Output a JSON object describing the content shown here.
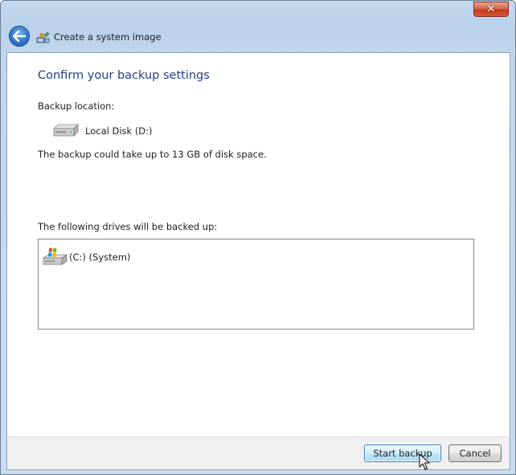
{
  "window": {
    "title": "Create a system image",
    "close_label": "✕"
  },
  "icons": {
    "back": "back-arrow-icon",
    "title": "backup-icon",
    "disk": "hard-disk-icon",
    "drive": "windows-drive-icon",
    "cursor": "mouse-pointer-icon"
  },
  "main": {
    "heading": "Confirm your backup settings",
    "location_label": "Backup location:",
    "location_value": "Local Disk (D:)",
    "space_note": "The backup could take up to 13 GB of disk space.",
    "drives_label": "The following drives will be backed up:",
    "drives": [
      {
        "label": "(C:) (System)"
      }
    ]
  },
  "footer": {
    "start_label": "Start backup",
    "cancel_label": "Cancel"
  },
  "colors": {
    "heading": "#1e3f8a",
    "frame": "#b9d1ea",
    "close": "#c4391c",
    "default_button_border": "#3c7fb1"
  }
}
